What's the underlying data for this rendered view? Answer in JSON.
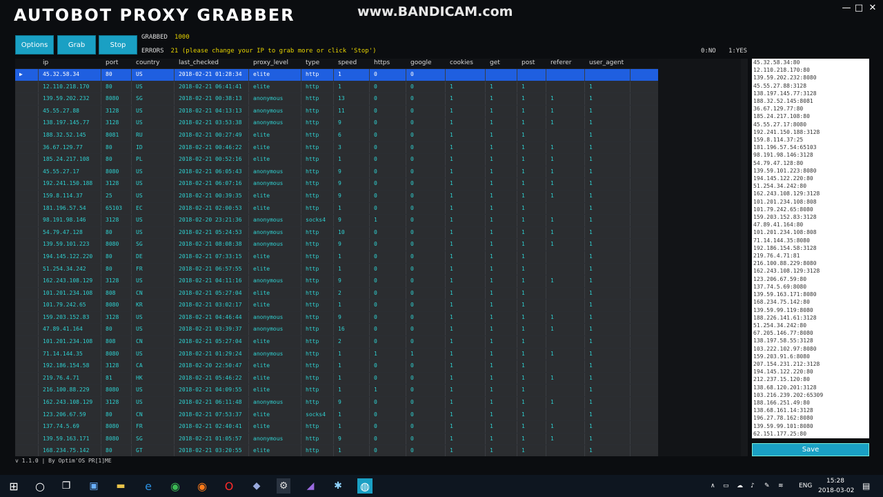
{
  "window": {
    "title": "AUTOBOT PROXY GRABBER",
    "watermark": "www.BANDICAM.com",
    "minimize": "—",
    "maximize": "□",
    "close": "✕"
  },
  "toolbar": {
    "options_label": "Options",
    "grab_label": "Grab",
    "stop_label": "Stop",
    "grabbed_label": "GRABBED",
    "grabbed_value": "1000",
    "errors_label": "ERRORS",
    "errors_value": "21 (please change your IP to grab more or click 'Stop')",
    "no_label": "0:NO",
    "yes_label": "1:YES"
  },
  "table": {
    "columns": [
      "ip",
      "port",
      "country",
      "last_checked",
      "proxy_level",
      "type",
      "speed",
      "https",
      "google",
      "cookies",
      "get",
      "post",
      "referer",
      "user_agent"
    ],
    "rows": [
      [
        "45.32.58.34",
        "80",
        "US",
        "2018-02-21 01:28:34",
        "elite",
        "http",
        "1",
        "0",
        "0",
        "",
        "",
        "",
        "",
        ""
      ],
      [
        "12.110.218.170",
        "80",
        "US",
        "2018-02-21 06:41:41",
        "elite",
        "http",
        "1",
        "0",
        "0",
        "1",
        "1",
        "1",
        "",
        "1"
      ],
      [
        "139.59.202.232",
        "8080",
        "SG",
        "2018-02-21 00:38:13",
        "anonymous",
        "http",
        "13",
        "0",
        "0",
        "1",
        "1",
        "1",
        "1",
        "1"
      ],
      [
        "45.55.27.88",
        "3128",
        "US",
        "2018-02-21 04:13:13",
        "anonymous",
        "http",
        "11",
        "0",
        "0",
        "1",
        "1",
        "1",
        "1",
        "1"
      ],
      [
        "138.197.145.77",
        "3128",
        "US",
        "2018-02-21 03:53:38",
        "anonymous",
        "http",
        "9",
        "0",
        "0",
        "1",
        "1",
        "1",
        "1",
        "1"
      ],
      [
        "188.32.52.145",
        "8081",
        "RU",
        "2018-02-21 00:27:49",
        "elite",
        "http",
        "6",
        "0",
        "0",
        "1",
        "1",
        "1",
        "",
        "1"
      ],
      [
        "36.67.129.77",
        "80",
        "ID",
        "2018-02-21 00:46:22",
        "elite",
        "http",
        "3",
        "0",
        "0",
        "1",
        "1",
        "1",
        "1",
        "1"
      ],
      [
        "185.24.217.108",
        "80",
        "PL",
        "2018-02-21 00:52:16",
        "elite",
        "http",
        "1",
        "0",
        "0",
        "1",
        "1",
        "1",
        "1",
        "1"
      ],
      [
        "45.55.27.17",
        "8080",
        "US",
        "2018-02-21 06:05:43",
        "anonymous",
        "http",
        "9",
        "0",
        "0",
        "1",
        "1",
        "1",
        "1",
        "1"
      ],
      [
        "192.241.150.188",
        "3128",
        "US",
        "2018-02-21 06:07:16",
        "anonymous",
        "http",
        "9",
        "0",
        "0",
        "1",
        "1",
        "1",
        "1",
        "1"
      ],
      [
        "159.8.114.37",
        "25",
        "US",
        "2018-02-21 00:39:35",
        "elite",
        "http",
        "9",
        "0",
        "0",
        "1",
        "1",
        "1",
        "1",
        "1"
      ],
      [
        "181.196.57.54",
        "65103",
        "EC",
        "2018-02-21 02:00:53",
        "elite",
        "http",
        "1",
        "0",
        "0",
        "1",
        "1",
        "1",
        "",
        "1"
      ],
      [
        "98.191.98.146",
        "3128",
        "US",
        "2018-02-20 23:21:36",
        "anonymous",
        "socks4",
        "9",
        "1",
        "0",
        "1",
        "1",
        "1",
        "1",
        "1"
      ],
      [
        "54.79.47.128",
        "80",
        "US",
        "2018-02-21 05:24:53",
        "anonymous",
        "http",
        "10",
        "0",
        "0",
        "1",
        "1",
        "1",
        "1",
        "1"
      ],
      [
        "139.59.101.223",
        "8080",
        "SG",
        "2018-02-21 08:08:38",
        "anonymous",
        "http",
        "9",
        "0",
        "0",
        "1",
        "1",
        "1",
        "1",
        "1"
      ],
      [
        "194.145.122.220",
        "80",
        "DE",
        "2018-02-21 07:33:15",
        "elite",
        "http",
        "1",
        "0",
        "0",
        "1",
        "1",
        "1",
        "",
        "1"
      ],
      [
        "51.254.34.242",
        "80",
        "FR",
        "2018-02-21 06:57:55",
        "elite",
        "http",
        "1",
        "0",
        "0",
        "1",
        "1",
        "1",
        "",
        "1"
      ],
      [
        "162.243.108.129",
        "3128",
        "US",
        "2018-02-21 04:11:16",
        "anonymous",
        "http",
        "9",
        "0",
        "0",
        "1",
        "1",
        "1",
        "1",
        "1"
      ],
      [
        "101.201.234.108",
        "808",
        "CN",
        "2018-02-21 05:27:04",
        "elite",
        "http",
        "2",
        "0",
        "0",
        "1",
        "1",
        "1",
        "",
        "1"
      ],
      [
        "101.79.242.65",
        "8080",
        "KR",
        "2018-02-21 03:02:17",
        "elite",
        "http",
        "1",
        "0",
        "0",
        "1",
        "1",
        "1",
        "",
        "1"
      ],
      [
        "159.203.152.83",
        "3128",
        "US",
        "2018-02-21 04:46:44",
        "anonymous",
        "http",
        "9",
        "0",
        "0",
        "1",
        "1",
        "1",
        "1",
        "1"
      ],
      [
        "47.89.41.164",
        "80",
        "US",
        "2018-02-21 03:39:37",
        "anonymous",
        "http",
        "16",
        "0",
        "0",
        "1",
        "1",
        "1",
        "1",
        "1"
      ],
      [
        "101.201.234.108",
        "808",
        "CN",
        "2018-02-21 05:27:04",
        "elite",
        "http",
        "2",
        "0",
        "0",
        "1",
        "1",
        "1",
        "",
        "1"
      ],
      [
        "71.14.144.35",
        "8080",
        "US",
        "2018-02-21 01:29:24",
        "anonymous",
        "http",
        "1",
        "1",
        "1",
        "1",
        "1",
        "1",
        "1",
        "1"
      ],
      [
        "192.186.154.58",
        "3128",
        "CA",
        "2018-02-20 22:50:47",
        "elite",
        "http",
        "1",
        "0",
        "0",
        "1",
        "1",
        "1",
        "",
        "1"
      ],
      [
        "219.76.4.71",
        "81",
        "HK",
        "2018-02-21 05:46:22",
        "elite",
        "http",
        "1",
        "0",
        "0",
        "1",
        "1",
        "1",
        "1",
        "1"
      ],
      [
        "216.100.88.229",
        "8080",
        "US",
        "2018-02-21 04:09:55",
        "elite",
        "http",
        "1",
        "1",
        "0",
        "1",
        "1",
        "1",
        "",
        "1"
      ],
      [
        "162.243.108.129",
        "3128",
        "US",
        "2018-02-21 06:11:48",
        "anonymous",
        "http",
        "9",
        "0",
        "0",
        "1",
        "1",
        "1",
        "1",
        "1"
      ],
      [
        "123.206.67.59",
        "80",
        "CN",
        "2018-02-21 07:53:37",
        "elite",
        "socks4",
        "1",
        "0",
        "0",
        "1",
        "1",
        "1",
        "",
        "1"
      ],
      [
        "137.74.5.69",
        "8080",
        "FR",
        "2018-02-21 02:40:41",
        "elite",
        "http",
        "1",
        "0",
        "0",
        "1",
        "1",
        "1",
        "1",
        "1"
      ],
      [
        "139.59.163.171",
        "8080",
        "SG",
        "2018-02-21 01:05:57",
        "anonymous",
        "http",
        "9",
        "0",
        "0",
        "1",
        "1",
        "1",
        "1",
        "1"
      ],
      [
        "168.234.75.142",
        "80",
        "GT",
        "2018-02-21 03:20:55",
        "elite",
        "http",
        "1",
        "0",
        "0",
        "1",
        "1",
        "1",
        "",
        "1"
      ]
    ]
  },
  "side_list": [
    "45.32.58.34:80",
    "12.110.218.170:80",
    "139.59.202.232:8080",
    "45.55.27.88:3128",
    "138.197.145.77:3128",
    "188.32.52.145:8081",
    "36.67.129.77:80",
    "185.24.217.108:80",
    "45.55.27.17:8080",
    "192.241.150.188:3128",
    "159.8.114.37:25",
    "181.196.57.54:65103",
    "98.191.98.146:3128",
    "54.79.47.128:80",
    "139.59.101.223:8080",
    "194.145.122.220:80",
    "51.254.34.242:80",
    "162.243.108.129:3128",
    "101.201.234.108:808",
    "101.79.242.65:8080",
    "159.203.152.83:3128",
    "47.89.41.164:80",
    "101.201.234.108:808",
    "71.14.144.35:8080",
    "192.186.154.58:3128",
    "219.76.4.71:81",
    "216.100.88.229:8080",
    "162.243.108.129:3128",
    "123.206.67.59:80",
    "137.74.5.69:8080",
    "139.59.163.171:8080",
    "168.234.75.142:80",
    "139.59.99.119:8080",
    "188.226.141.61:3128",
    "51.254.34.242:80",
    "67.205.146.77:8080",
    "138.197.58.55:3128",
    "103.222.102.97:8080",
    "159.203.91.6:8080",
    "207.154.231.212:3128",
    "194.145.122.220:80",
    "212.237.15.120:80",
    "138.68.120.201:3128",
    "103.216.239.202:65309",
    "188.166.251.49:80",
    "138.68.161.14:3128",
    "196.27.78.162:8080",
    "139.59.99.101:8080",
    "62.151.177.25:80"
  ],
  "save_label": "Save",
  "footer": "v 1.1.0 | By Optim'OS PR[1]ME",
  "taskbar": {
    "language": "ENG",
    "time": "15:28",
    "date": "2018-03-02"
  }
}
